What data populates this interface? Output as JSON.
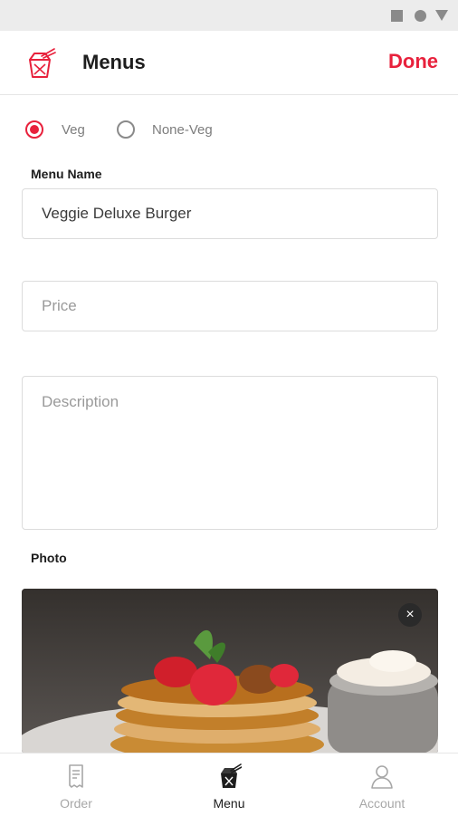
{
  "app": {
    "title": "Menus",
    "done_label": "Done"
  },
  "colors": {
    "accent": "#e8213c",
    "status_bar": "#ececec"
  },
  "form": {
    "veg_type": {
      "options": [
        {
          "label": "Veg",
          "selected": true
        },
        {
          "label": "None-Veg",
          "selected": false
        }
      ]
    },
    "menu_name": {
      "label": "Menu Name",
      "value": "Veggie Deluxe Burger"
    },
    "price": {
      "placeholder": "Price"
    },
    "description": {
      "placeholder": "Description"
    },
    "photo": {
      "label": "Photo",
      "close_icon": "close-icon",
      "close_glyph": "×"
    }
  },
  "tabbar": {
    "items": [
      {
        "label": "Order",
        "icon": "receipt-icon",
        "active": false
      },
      {
        "label": "Menu",
        "icon": "takeout-box-icon",
        "active": true
      },
      {
        "label": "Account",
        "icon": "user-icon",
        "active": false
      }
    ]
  }
}
